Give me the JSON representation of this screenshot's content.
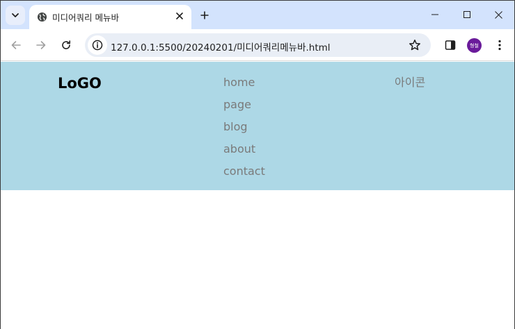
{
  "browser": {
    "tab": {
      "title": "미디어쿼리 메뉴바"
    },
    "address_bar": {
      "url": "127.0.0.1:5500/20240201/미디어쿼리메뉴바.html"
    },
    "profile": {
      "initials": "형철",
      "color": "#6a1b9a"
    }
  },
  "page": {
    "background_color": "#add8e6",
    "logo": "LoGO",
    "menu": [
      {
        "label": "home"
      },
      {
        "label": "page"
      },
      {
        "label": "blog"
      },
      {
        "label": "about"
      },
      {
        "label": "contact"
      }
    ],
    "icon_area_label": "아이콘"
  }
}
